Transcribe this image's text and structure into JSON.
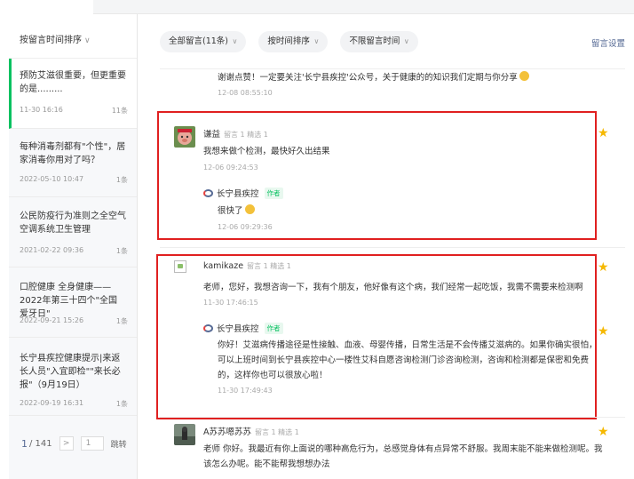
{
  "sidebar": {
    "sort_label": "按留言时间排序",
    "articles": [
      {
        "title": "预防艾滋很重要，但更重要的是.........",
        "date": "11-30 16:16",
        "count": "11条"
      },
      {
        "title": "每种消毒剂都有\"个性\"，居家消毒你用对了吗？",
        "date": "2022-05-10 10:47",
        "count": "1条"
      },
      {
        "title": "公民防疫行为准则之全空气空调系统卫生管理",
        "date": "2021-02-22 09:36",
        "count": "1条"
      },
      {
        "title": "口腔健康 全身健康——2022年第三十四个\"全国爱牙日\"",
        "date": "2022-09-21 15:26",
        "count": "1条"
      },
      {
        "title": "长宁县疾控健康提示|来返长人员\"入宜即检\"\"来长必报\"（9月19日）",
        "date": "2022-09-19 16:31",
        "count": "1条"
      }
    ],
    "pager": {
      "current": "1",
      "total": "/ 141",
      "next": ">",
      "input": "1",
      "jump": "跳转"
    }
  },
  "filters": {
    "all": "全部留言(11条)",
    "order": "按时间排序",
    "time": "不限留言时间"
  },
  "settings_label": "留言设置",
  "reply_top": {
    "text": "谢谢点赞！一定要关注'长宁县疾控'公众号，关于健康的的知识我们定期与你分享",
    "time": "12-08 08:55:10"
  },
  "comments": [
    {
      "name": "谦益",
      "sub": "留言 1  精选 1",
      "text": "我想来做个检测，最快好久出结果",
      "time": "12-06 09:24:53",
      "reply": {
        "author": "长宁县疾控",
        "tag": "作者",
        "text": "很快了",
        "time": "12-06 09:29:36"
      }
    },
    {
      "name": "kamikaze",
      "sub": "留言 1  精选 1",
      "text": "老师，您好，我想咨询一下，我有个朋友，他好像有这个病，我们经常一起吃饭，我需不需要来检测啊",
      "time": "11-30 17:46:15",
      "reply": {
        "author": "长宁县疾控",
        "tag": "作者",
        "lines": [
          "你好！艾滋病传播途径是性接触、血液、母婴传播，日常生活是不会传播艾滋病的。如果你确实很怕，",
          "可以上班时间到长宁县疾控中心一楼性艾科自愿咨询检测门诊咨询检测，咨询和检测都是保密和免费",
          "的，这样你也可以很放心啦！"
        ],
        "time": "11-30 17:49:43"
      }
    },
    {
      "name": "A苏苏嗯苏苏",
      "sub": "留言 1  精选 1",
      "lines": [
        "老师 你好。我最近有你上面说的哪种高危行为，总感觉身体有点异常不舒服。我周末能不能来做检测呢。我",
        "该怎么办呢。能不能帮我想想办法"
      ]
    }
  ]
}
